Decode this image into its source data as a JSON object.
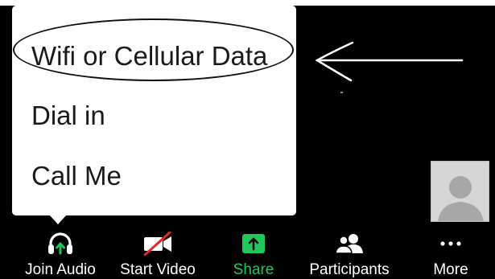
{
  "audio_menu": {
    "items": [
      {
        "label": "Wifi or Cellular Data"
      },
      {
        "label": "Dial in"
      },
      {
        "label": "Call Me"
      }
    ]
  },
  "toolbar": {
    "join_audio": {
      "label": "Join Audio",
      "icon": "headphones-icon"
    },
    "start_video": {
      "label": "Start Video",
      "icon": "video-off-icon"
    },
    "share": {
      "label": "Share",
      "icon": "share-arrow-icon"
    },
    "participants": {
      "label": "Participants",
      "icon": "participants-icon"
    },
    "more": {
      "label": "More",
      "icon": "more-dots-icon"
    }
  },
  "colors": {
    "background": "#000000",
    "menu_background": "#ffffff",
    "share_accent": "#1ec85a",
    "video_off_slash": "#e02828",
    "thumbnail_background": "#d6d6d6"
  }
}
